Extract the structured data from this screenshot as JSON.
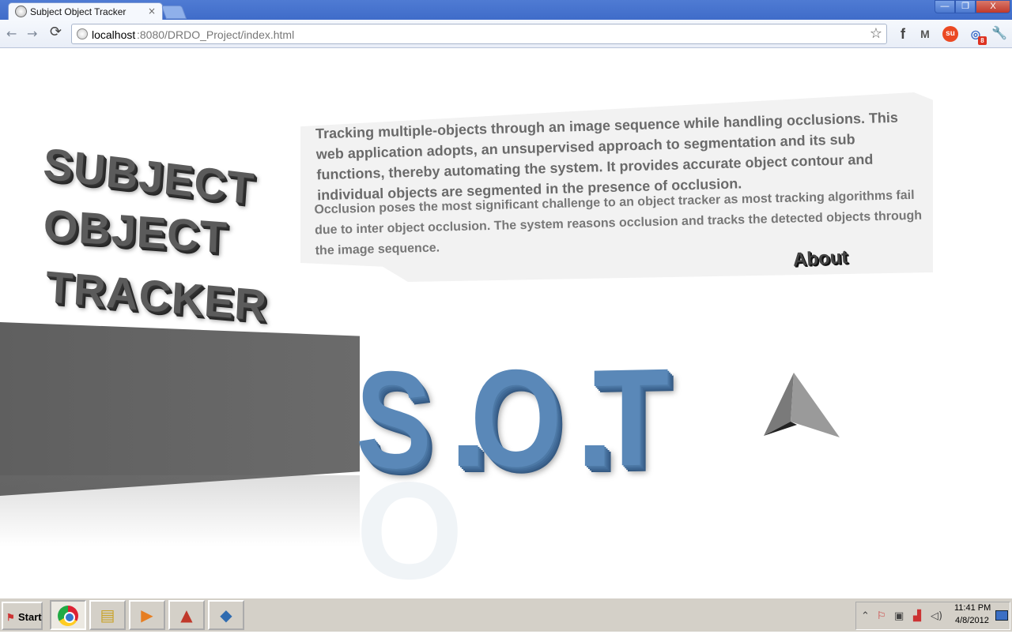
{
  "browser": {
    "tab_title": "Subject Object Tracker",
    "tab_close": "×",
    "window_min": "—",
    "window_max": "❐",
    "window_close": "X",
    "url_host": "localhost",
    "url_path": ":8080/DRDO_Project/index.html",
    "nav": {
      "back": "←",
      "forward": "→",
      "reload": "⟳",
      "bookmark": "☆"
    },
    "extensions": {
      "facebook": "f",
      "gmail": "M",
      "stumbleupon": "su",
      "rss": "◎",
      "rss_badge": "8",
      "wrench": "🔧"
    }
  },
  "page": {
    "title_lines": [
      "SUBJECT",
      "OBJECT",
      "TRACKER"
    ],
    "description_intro": "Tracking multiple-objects through an image sequence while handling occlusions. This web application adopts, an unsupervised approach to segmentation and its sub functions, thereby automating the system. It provides accurate object contour and individual objects are segmented in the presence of occlusion.",
    "description_detail": "Occlusion poses the most significant challenge to an object tracker as most tracking algorithms fail due to inter object occlusion. The system reasons occlusion and tracks the detected objects through the image sequence.",
    "about_link": "About",
    "logo": {
      "s": "S",
      "dot1": ".",
      "o": "O",
      "dot2": ".",
      "t": "T"
    },
    "colors": {
      "logo_blue": "#5a88b8",
      "ramp_gray": "#646464",
      "title_gray": "#5b5b5b",
      "bubble": "#f2f2f2"
    }
  },
  "taskbar": {
    "start_label": "Start",
    "apps": [
      "chrome-icon",
      "explorer-icon",
      "media-player-icon",
      "matlab-icon",
      "virtualbox-icon"
    ],
    "clock_time": "11:41 PM",
    "clock_date": "4/8/2012"
  }
}
